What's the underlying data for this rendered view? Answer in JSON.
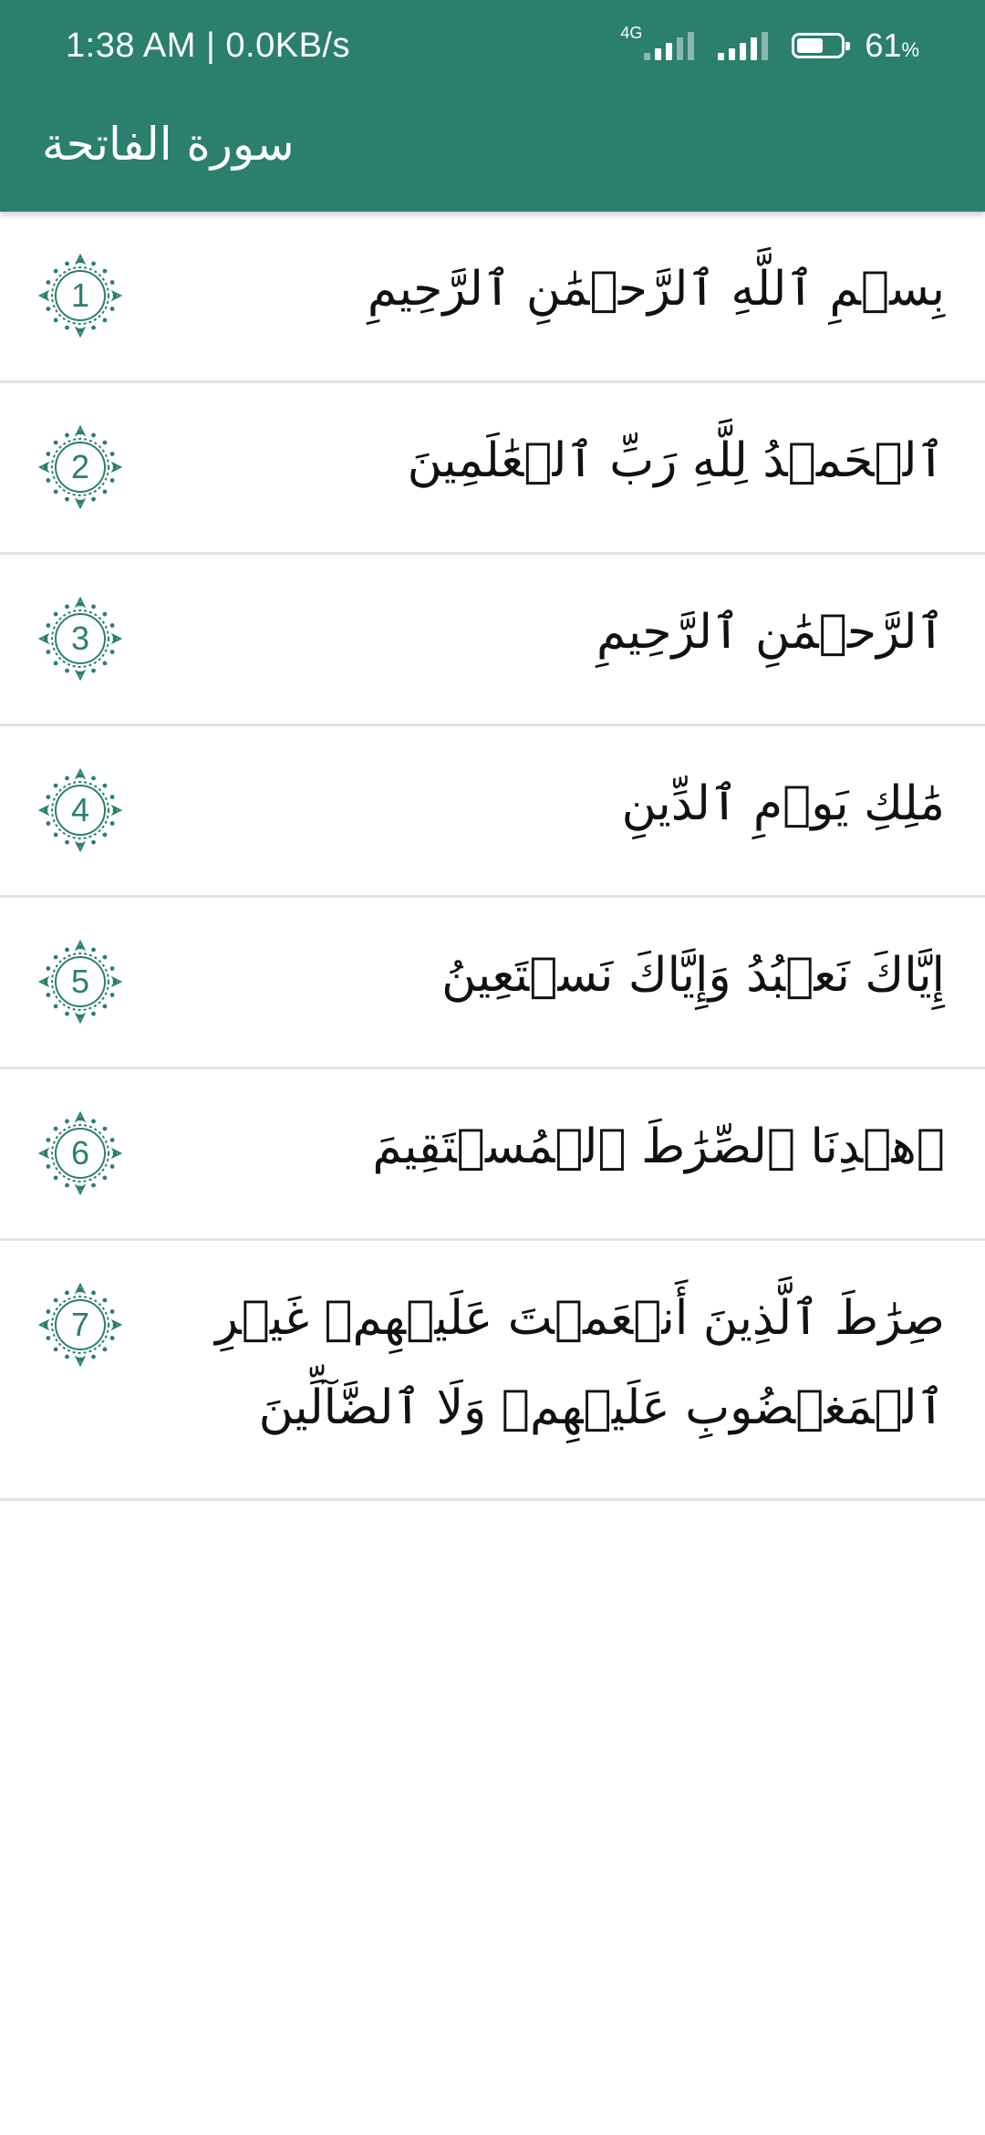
{
  "status_bar": {
    "time_speed": "1:38 AM | 0.0KB/s",
    "network_type": "4G",
    "battery_percent": "61",
    "battery_unit": "%",
    "battery_level": 0.61
  },
  "app_bar": {
    "title": "سورة الفاتحة"
  },
  "colors": {
    "primary": "#2b7f6d",
    "divider": "#e3e3e3",
    "text": "#111111"
  },
  "ayahs": [
    {
      "number": "1",
      "text": "بِسۡمِ ٱللَّهِ ٱلرَّحۡمَٰنِ ٱلرَّحِيمِ"
    },
    {
      "number": "2",
      "text": "ٱلۡحَمۡدُ لِلَّهِ رَبِّ ٱلۡعَٰلَمِينَ"
    },
    {
      "number": "3",
      "text": "ٱلرَّحۡمَٰنِ ٱلرَّحِيمِ"
    },
    {
      "number": "4",
      "text": "مَٰلِكِ يَوۡمِ ٱلدِّينِ"
    },
    {
      "number": "5",
      "text": "إِيَّاكَ نَعۡبُدُ وَإِيَّاكَ نَسۡتَعِينُ"
    },
    {
      "number": "6",
      "text": "ٱهۡدِنَا ٱلصِّرَٰطَ ٱلۡمُسۡتَقِيمَ"
    },
    {
      "number": "7",
      "text": "صِرَٰطَ ٱلَّذِينَ أَنۡعَمۡتَ عَلَيۡهِمۡ غَيۡرِ ٱلۡمَغۡضُوبِ عَلَيۡهِمۡ وَلَا ٱلضَّآلِّينَ"
    }
  ]
}
